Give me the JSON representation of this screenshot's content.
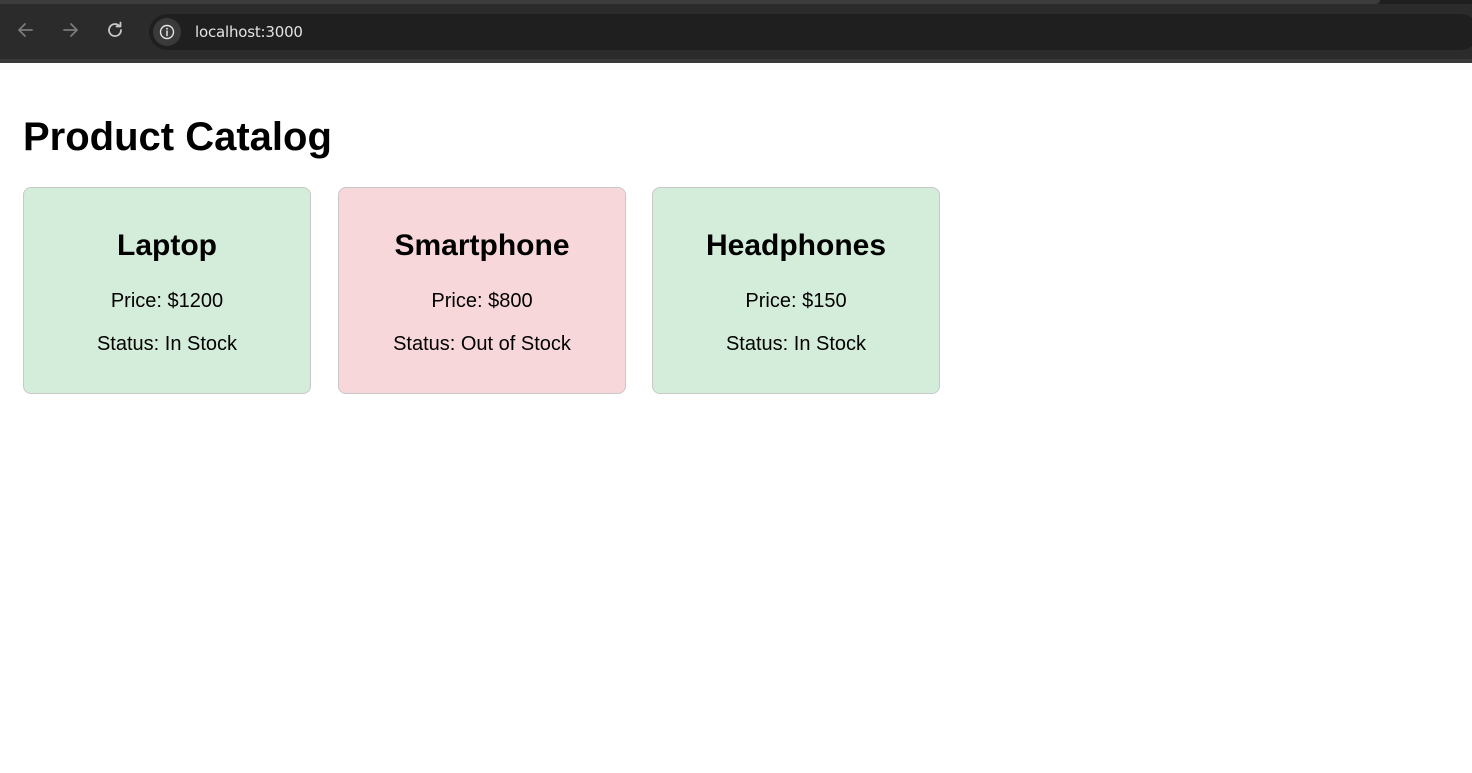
{
  "browser": {
    "url": "localhost:3000",
    "back_icon": "arrow-left-icon",
    "forward_icon": "arrow-right-icon",
    "reload_icon": "reload-icon",
    "site_info_icon": "info-icon"
  },
  "page": {
    "title": "Product Catalog"
  },
  "products": [
    {
      "name": "Laptop",
      "price_text": "Price: $1200",
      "status_text": "Status: In Stock",
      "background": "#d4edda"
    },
    {
      "name": "Smartphone",
      "price_text": "Price: $800",
      "status_text": "Status: Out of Stock",
      "background": "#f8d7da"
    },
    {
      "name": "Headphones",
      "price_text": "Price: $150",
      "status_text": "Status: In Stock",
      "background": "#d4edda"
    }
  ]
}
